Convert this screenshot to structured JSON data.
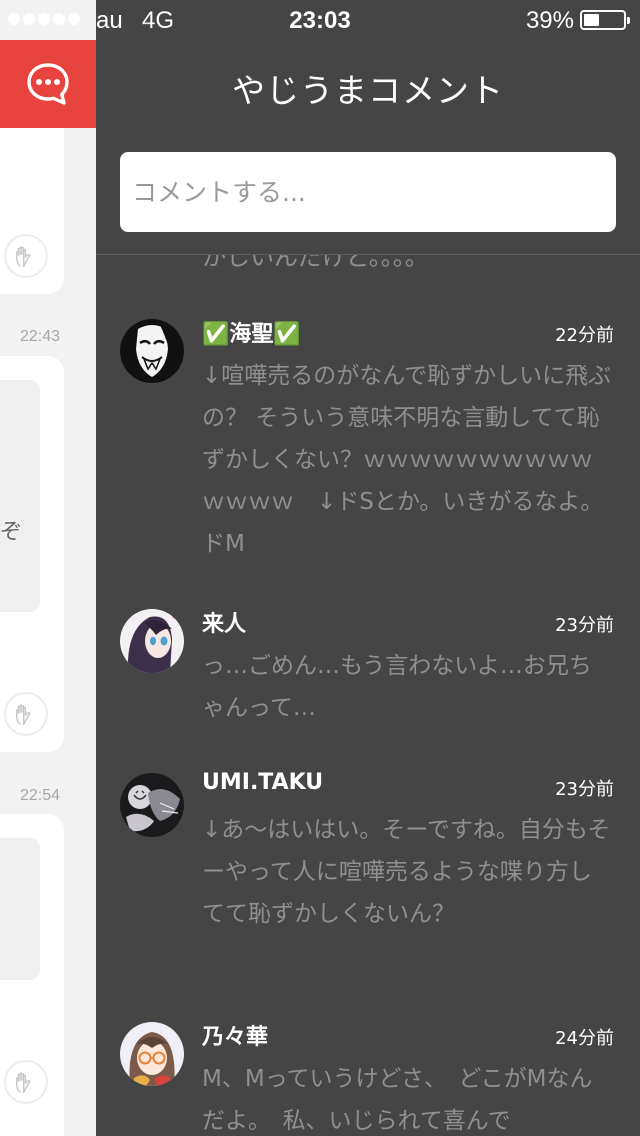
{
  "status_bar": {
    "carrier": "au",
    "network": "4G",
    "time": "23:03",
    "battery_percent": "39%",
    "battery_level": 0.39
  },
  "left_pane": {
    "timestamps": [
      "22:43",
      "22:54"
    ],
    "partial_glyph": "ぞ",
    "fab_icon": "speech-bubble-ellipsis-icon",
    "reaction_icon": "hand-icon"
  },
  "panel": {
    "title": "やじうまコメント",
    "input_placeholder": "コメントする...",
    "partial_previous_comment": "かしいんだけど。。。。"
  },
  "comments": [
    {
      "username": "✅海聖✅",
      "time": "22分前",
      "text": "↓喧嘩売るのがなんで恥ずかしいに飛ぶの？ そういう意味不明な言動してて恥ずかしくない？ｗｗｗｗｗｗｗｗｗｗｗｗｗｗ　↓ドSとか。いきがるなよ。ドM",
      "avatar": "mask-avatar"
    },
    {
      "username": "来人",
      "time": "23分前",
      "text": "っ…ごめん…もう言わないよ…お兄ちゃんって…",
      "avatar": "anime-girl-avatar"
    },
    {
      "username": "UMI.TAKU",
      "time": "23分前",
      "text": "↓あ〜はいはい。そーですね。自分もそーやって人に喧嘩売るような喋り方してて恥ずかしくないん？",
      "avatar": "dark-art-avatar"
    },
    {
      "username": "乃々華",
      "time": "24分前",
      "text": "M、Mっていうけどさ、　どこがMなんだよ。　私、いじられて喜んで",
      "avatar": "anime-glasses-avatar"
    }
  ],
  "colors": {
    "accent_red": "#e8433e",
    "panel_bg": "#454545",
    "muted_text": "#8f8f8f"
  }
}
